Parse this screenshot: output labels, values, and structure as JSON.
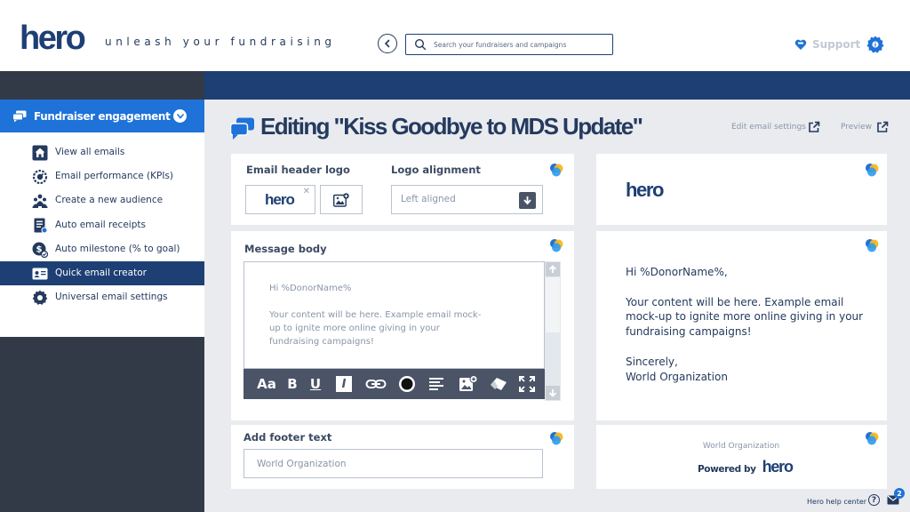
{
  "header": {
    "logo": "hero",
    "tagline": "unleash your fundraising",
    "search_placeholder": "Search your fundraisers and campaigns",
    "support_label": "Support"
  },
  "sidebar": {
    "section_title": "Fundraiser engagement",
    "items": [
      {
        "label": "View all emails",
        "icon": "home-icon"
      },
      {
        "label": "Email performance (KPIs)",
        "icon": "gauge-icon"
      },
      {
        "label": "Create a new audience",
        "icon": "people-icon"
      },
      {
        "label": "Auto email receipts",
        "icon": "receipt-icon"
      },
      {
        "label": "Auto milestone (% to goal)",
        "icon": "milestone-icon"
      },
      {
        "label": "Quick email creator",
        "icon": "id-card-icon"
      },
      {
        "label": "Universal email settings",
        "icon": "settings-icon"
      }
    ],
    "active_index": 5
  },
  "page": {
    "title": "Editing \"Kiss Goodbye to MDS Update\"",
    "edit_settings_label": "Edit email settings",
    "preview_label": "Preview"
  },
  "editor": {
    "header_logo_label": "Email header logo",
    "header_logo_value": "hero",
    "logo_alignment_label": "Logo alignment",
    "logo_alignment_value": "Left aligned",
    "message_body_label": "Message body",
    "message_body_text": "Hi %DonorName%\n\nYour content will be here. Example email mock-up to ignite more online giving in your fundraising campaigns!",
    "footer_label": "Add footer text",
    "footer_value": "World Organization",
    "toolbar_font_label": "Aa",
    "toolbar_bold_label": "B",
    "toolbar_underline_label": "U",
    "toolbar_italic_label": "I"
  },
  "preview": {
    "logo": "hero",
    "body": "Hi %DonorName%,\n\nYour content will be here.  Example email mock-up to ignite more online giving in your fundraising campaigns!\n\nSincerely,\nWorld Organization",
    "footer_org": "World Organization",
    "powered_by": "Powered by",
    "powered_logo": "hero"
  },
  "footer": {
    "help_center": "Hero help center",
    "help_glyph": "?",
    "mail_badge": "2"
  },
  "colors": {
    "navy": "#1d3f74",
    "accent_blue": "#1e72d8",
    "sidebar_dark": "#333a47",
    "toolbar": "#4a5466",
    "background": "#e9ebef"
  }
}
